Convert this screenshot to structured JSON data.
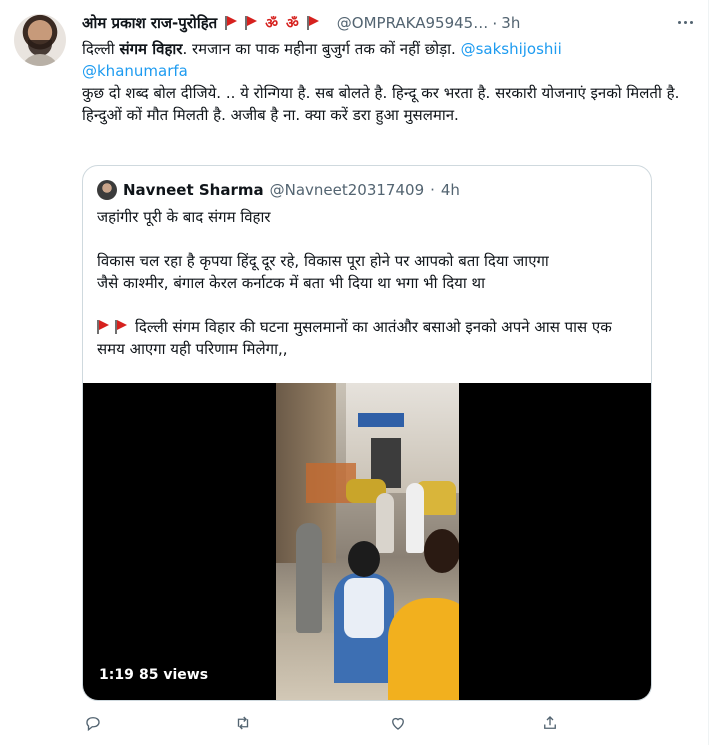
{
  "tweet": {
    "author_name": "ओम प्रकाश राज-पुरोहित",
    "name_om_1": "ॐ",
    "name_om_2": "ॐ",
    "handle": "@OMPRAKA95945…",
    "dot": "·",
    "time": "3h",
    "line1_a": "दिल्ली ",
    "line1_bold": "संगम विहार",
    "line1_b": ". रमजान का पाक महीना बुजुर्ग तक कों नहीं छोड़ा. ",
    "mention_1": "@sakshijoshii",
    "mention_2": "@khanumarfa",
    "line3": "कुछ दो शब्द बोल दीजिये. .. ये रोन्गिया है. सब बोलते है. हिन्दू कर भरता है. सरकारी योजनाएं इनको मिलती है. हिन्दुओं कों मौत मिलती है. अजीब है ना. क्या करें डरा हुआ मुसलमान."
  },
  "quote": {
    "author_name": "Navneet Sharma",
    "handle": "@Navneet20317409",
    "dot": "·",
    "time": "4h",
    "para1": "जहांगीर पूरी के बाद संगम विहार",
    "para2_line1": "विकास चल रहा है कृपया हिंदू दूर रहे, विकास पूरा होने पर आपको बता दिया जाएगा",
    "para2_line2": "जैसे काश्मीर, बंगाल केरल कर्नाटक में बता भी दिया था भगा भी दिया था",
    "para3": "दिल्ली संगम विहार की घटना मुसलमानों का आतंऔर बसाओ इनको अपने आस पास एक समय आएगा यही परिणाम मिलेगा,,",
    "video_duration": "1:19",
    "video_views": "85 views"
  },
  "icons": {
    "flag": "red-flag-icon",
    "reply": "reply-icon",
    "retweet": "retweet-icon",
    "like": "like-icon",
    "share": "share-icon",
    "more": "more-icon"
  },
  "colors": {
    "link": "#1d9bf0",
    "secondary_text": "#536471",
    "flag_red": "#d6211e",
    "border": "#cfd9de"
  }
}
